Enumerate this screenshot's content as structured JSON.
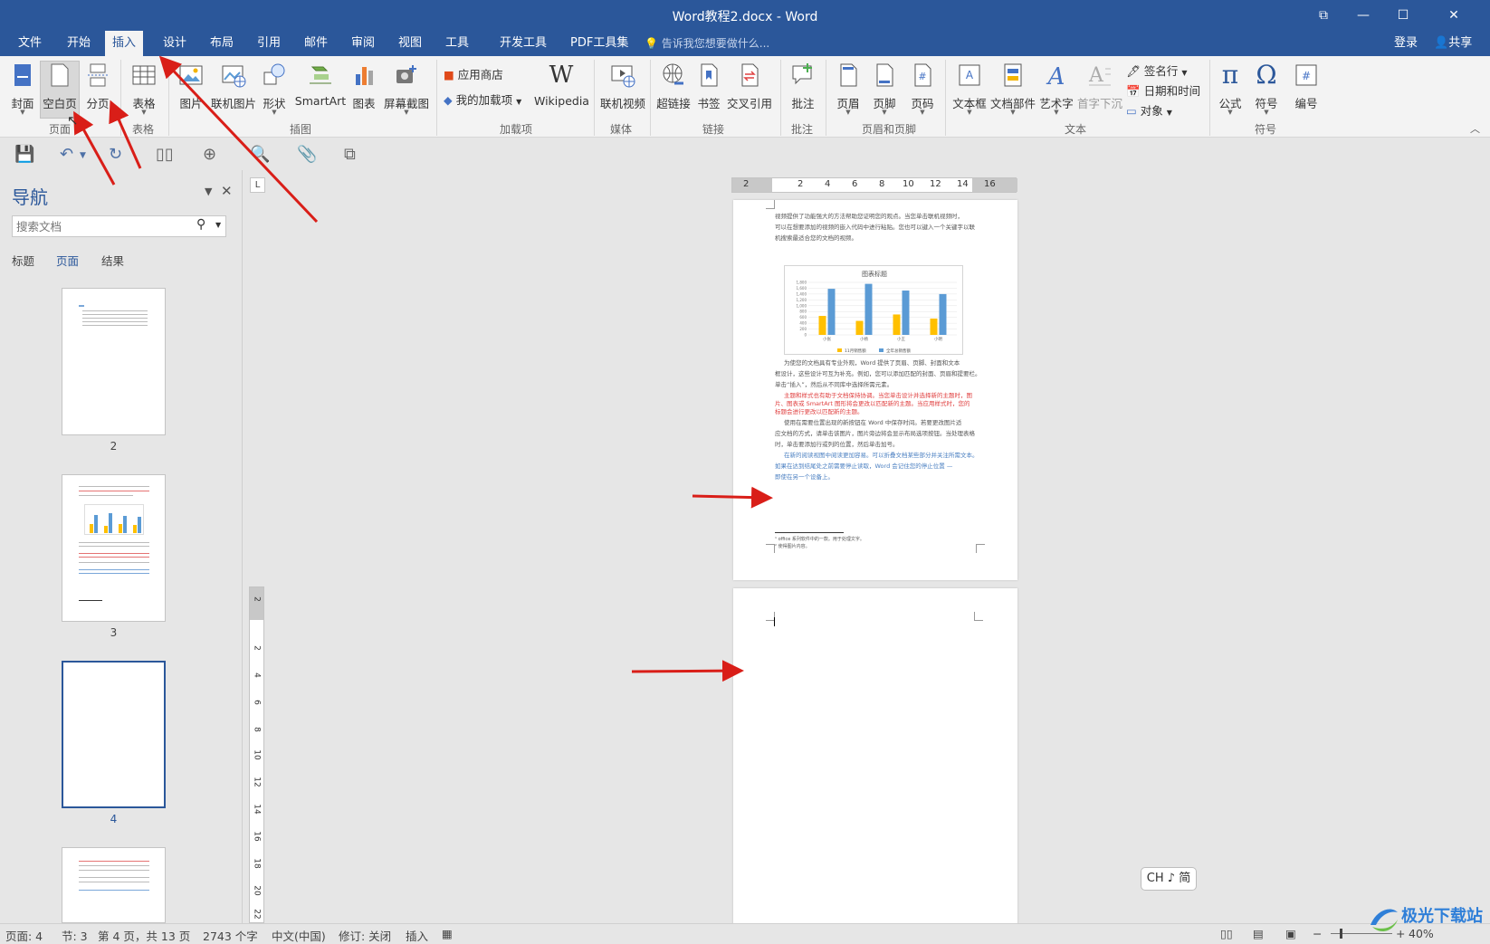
{
  "window": {
    "title": "Word教程2.docx - Word",
    "controls": [
      "⧉",
      "—",
      "☐",
      "✕"
    ]
  },
  "tabs": [
    {
      "label": "文件",
      "active": false
    },
    {
      "label": "开始",
      "active": false
    },
    {
      "label": "插入",
      "active": true
    },
    {
      "label": "设计",
      "active": false
    },
    {
      "label": "布局",
      "active": false
    },
    {
      "label": "引用",
      "active": false
    },
    {
      "label": "邮件",
      "active": false
    },
    {
      "label": "审阅",
      "active": false
    },
    {
      "label": "视图",
      "active": false
    },
    {
      "label": "工具",
      "active": false
    },
    {
      "label": "开发工具",
      "active": false
    },
    {
      "label": "PDF工具集",
      "active": false
    }
  ],
  "tellme": "告诉我您想要做什么...",
  "account": {
    "login": "登录",
    "share": "共享"
  },
  "ribbon": {
    "buttons": [
      "封面",
      "空白页",
      "分页",
      "表格",
      "图片",
      "联机图片",
      "形状",
      "SmartArt",
      "图表",
      "屏幕截图",
      "Wikipedia",
      "联机视频",
      "超链接",
      "书签",
      "交叉引用",
      "批注",
      "页眉",
      "页脚",
      "页码",
      "文本框",
      "文档部件",
      "艺术字",
      "首字下沉",
      "公式",
      "符号",
      "编号"
    ],
    "small": [
      "应用商店",
      "我的加载项",
      "签名行",
      "日期和时间",
      "对象"
    ],
    "groups": [
      "页面",
      "表格",
      "插图",
      "加载项",
      "媒体",
      "链接",
      "批注",
      "页眉和页脚",
      "文本",
      "符号"
    ],
    "wiki_glyph": "W",
    "formula_glyph": "π",
    "symbol_glyph": "Ω"
  },
  "nav": {
    "title": "导航",
    "search_placeholder": "搜索文档",
    "tabs": [
      "标题",
      "页面",
      "结果"
    ],
    "thumbs": [
      "2",
      "3",
      "4"
    ]
  },
  "ruler": {
    "h": [
      "2",
      "2",
      "4",
      "6",
      "8",
      "10",
      "12",
      "14",
      "16"
    ],
    "v": [
      "2",
      "2",
      "4",
      "6",
      "8",
      "10",
      "12",
      "14",
      "16",
      "18",
      "20",
      "22"
    ],
    "tab_marker": "L"
  },
  "page1": {
    "lines": [
      {
        "t": "视频提供了功能强大的方法帮助您证明您的观点。当您单击联机视频时，",
        "c": "dark"
      },
      {
        "t": "可以在想要添加的视频的嵌入代码中进行粘贴。您也可以键入一个关键字以联",
        "c": "dark"
      },
      {
        "t": "机搜索最适合您的文档的视频。",
        "c": "dark"
      },
      {
        "t": "为使您的文档具有专业外观，Word 提供了页眉、页脚、封面和文本",
        "c": "dark"
      },
      {
        "t": "框设计，这些设计可互为补充。例如，您可以添加匹配的封面、页眉和提要栏。",
        "c": "dark"
      },
      {
        "t": "单击“插入”，然后从不同库中选择所需元素。",
        "c": "dark"
      },
      {
        "t": "主题和样式也有助于文档保持协调。当您单击设计并选择新的主题时，图",
        "c": "red"
      },
      {
        "t": "片、图表或 SmartArt 图形将会更改以匹配新的主题。当应用样式时，您的",
        "c": "red"
      },
      {
        "t": "标题会进行更改以匹配新的主题。",
        "c": "red"
      },
      {
        "t": "使用在需要位置出现的新按钮在 Word 中保存时间。若要更改图片适",
        "c": "dark"
      },
      {
        "t": "应文档的方式，请单击该图片，图片旁边将会显示布局选项按钮。当处理表格",
        "c": "dark"
      },
      {
        "t": "时，单击要添加行或列的位置，然后单击加号。",
        "c": "dark"
      },
      {
        "t": "在新的阅读视图中阅读更加容易。可以折叠文档某些部分并关注所需文本。",
        "c": "blue"
      },
      {
        "t": "如果在达到结尾处之前需要停止读取，Word 会记住您的停止位置 —",
        "c": "blue"
      },
      {
        "t": "即使在另一个设备上。",
        "c": "blue"
      }
    ],
    "footnotes": [
      "¹ office 系列软件中的一款。用于处理文字。",
      "² 使得图片内容。"
    ]
  },
  "chart_data": {
    "type": "bar",
    "title": "图表标题",
    "categories": [
      "小张",
      "小杨",
      "小王",
      "小明"
    ],
    "series": [
      {
        "name": "11月销售额",
        "color": "#ffc000",
        "values": [
          650,
          480,
          700,
          560
        ]
      },
      {
        "name": "全年总销售额",
        "color": "#5b9bd5",
        "values": [
          1580,
          1750,
          1520,
          1400
        ]
      }
    ],
    "yticks": [
      "1,800",
      "1,600",
      "1,400",
      "1,200",
      "1,000",
      "800",
      "600",
      "400",
      "200",
      "0"
    ],
    "ylim": [
      0,
      1800
    ]
  },
  "ime": "CH ♪ 简",
  "status": {
    "page": "页面: 4",
    "section": "节: 3",
    "pages": "第 4 页，共 13 页",
    "words": "2743 个字",
    "lang": "中文(中国)",
    "track": "修订: 关闭",
    "mode": "插入",
    "zoom": "40%"
  },
  "watermark": "极光下载站"
}
